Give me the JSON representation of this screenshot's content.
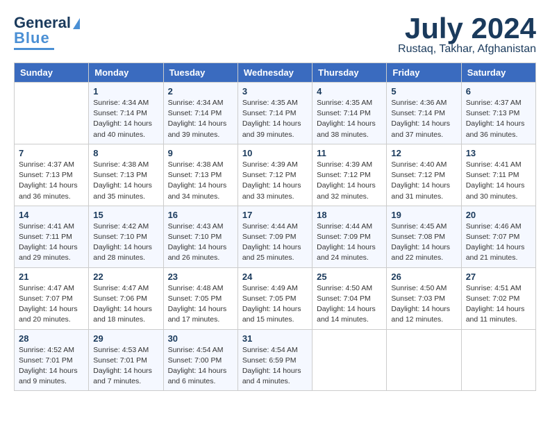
{
  "header": {
    "logo_line1": "General",
    "logo_line2": "Blue",
    "month": "July 2024",
    "location": "Rustaq, Takhar, Afghanistan"
  },
  "days_of_week": [
    "Sunday",
    "Monday",
    "Tuesday",
    "Wednesday",
    "Thursday",
    "Friday",
    "Saturday"
  ],
  "weeks": [
    [
      {
        "num": "",
        "sunrise": "",
        "sunset": "",
        "daylight": ""
      },
      {
        "num": "1",
        "sunrise": "Sunrise: 4:34 AM",
        "sunset": "Sunset: 7:14 PM",
        "daylight": "Daylight: 14 hours and 40 minutes."
      },
      {
        "num": "2",
        "sunrise": "Sunrise: 4:34 AM",
        "sunset": "Sunset: 7:14 PM",
        "daylight": "Daylight: 14 hours and 39 minutes."
      },
      {
        "num": "3",
        "sunrise": "Sunrise: 4:35 AM",
        "sunset": "Sunset: 7:14 PM",
        "daylight": "Daylight: 14 hours and 39 minutes."
      },
      {
        "num": "4",
        "sunrise": "Sunrise: 4:35 AM",
        "sunset": "Sunset: 7:14 PM",
        "daylight": "Daylight: 14 hours and 38 minutes."
      },
      {
        "num": "5",
        "sunrise": "Sunrise: 4:36 AM",
        "sunset": "Sunset: 7:14 PM",
        "daylight": "Daylight: 14 hours and 37 minutes."
      },
      {
        "num": "6",
        "sunrise": "Sunrise: 4:37 AM",
        "sunset": "Sunset: 7:13 PM",
        "daylight": "Daylight: 14 hours and 36 minutes."
      }
    ],
    [
      {
        "num": "7",
        "sunrise": "Sunrise: 4:37 AM",
        "sunset": "Sunset: 7:13 PM",
        "daylight": "Daylight: 14 hours and 36 minutes."
      },
      {
        "num": "8",
        "sunrise": "Sunrise: 4:38 AM",
        "sunset": "Sunset: 7:13 PM",
        "daylight": "Daylight: 14 hours and 35 minutes."
      },
      {
        "num": "9",
        "sunrise": "Sunrise: 4:38 AM",
        "sunset": "Sunset: 7:13 PM",
        "daylight": "Daylight: 14 hours and 34 minutes."
      },
      {
        "num": "10",
        "sunrise": "Sunrise: 4:39 AM",
        "sunset": "Sunset: 7:12 PM",
        "daylight": "Daylight: 14 hours and 33 minutes."
      },
      {
        "num": "11",
        "sunrise": "Sunrise: 4:39 AM",
        "sunset": "Sunset: 7:12 PM",
        "daylight": "Daylight: 14 hours and 32 minutes."
      },
      {
        "num": "12",
        "sunrise": "Sunrise: 4:40 AM",
        "sunset": "Sunset: 7:12 PM",
        "daylight": "Daylight: 14 hours and 31 minutes."
      },
      {
        "num": "13",
        "sunrise": "Sunrise: 4:41 AM",
        "sunset": "Sunset: 7:11 PM",
        "daylight": "Daylight: 14 hours and 30 minutes."
      }
    ],
    [
      {
        "num": "14",
        "sunrise": "Sunrise: 4:41 AM",
        "sunset": "Sunset: 7:11 PM",
        "daylight": "Daylight: 14 hours and 29 minutes."
      },
      {
        "num": "15",
        "sunrise": "Sunrise: 4:42 AM",
        "sunset": "Sunset: 7:10 PM",
        "daylight": "Daylight: 14 hours and 28 minutes."
      },
      {
        "num": "16",
        "sunrise": "Sunrise: 4:43 AM",
        "sunset": "Sunset: 7:10 PM",
        "daylight": "Daylight: 14 hours and 26 minutes."
      },
      {
        "num": "17",
        "sunrise": "Sunrise: 4:44 AM",
        "sunset": "Sunset: 7:09 PM",
        "daylight": "Daylight: 14 hours and 25 minutes."
      },
      {
        "num": "18",
        "sunrise": "Sunrise: 4:44 AM",
        "sunset": "Sunset: 7:09 PM",
        "daylight": "Daylight: 14 hours and 24 minutes."
      },
      {
        "num": "19",
        "sunrise": "Sunrise: 4:45 AM",
        "sunset": "Sunset: 7:08 PM",
        "daylight": "Daylight: 14 hours and 22 minutes."
      },
      {
        "num": "20",
        "sunrise": "Sunrise: 4:46 AM",
        "sunset": "Sunset: 7:07 PM",
        "daylight": "Daylight: 14 hours and 21 minutes."
      }
    ],
    [
      {
        "num": "21",
        "sunrise": "Sunrise: 4:47 AM",
        "sunset": "Sunset: 7:07 PM",
        "daylight": "Daylight: 14 hours and 20 minutes."
      },
      {
        "num": "22",
        "sunrise": "Sunrise: 4:47 AM",
        "sunset": "Sunset: 7:06 PM",
        "daylight": "Daylight: 14 hours and 18 minutes."
      },
      {
        "num": "23",
        "sunrise": "Sunrise: 4:48 AM",
        "sunset": "Sunset: 7:05 PM",
        "daylight": "Daylight: 14 hours and 17 minutes."
      },
      {
        "num": "24",
        "sunrise": "Sunrise: 4:49 AM",
        "sunset": "Sunset: 7:05 PM",
        "daylight": "Daylight: 14 hours and 15 minutes."
      },
      {
        "num": "25",
        "sunrise": "Sunrise: 4:50 AM",
        "sunset": "Sunset: 7:04 PM",
        "daylight": "Daylight: 14 hours and 14 minutes."
      },
      {
        "num": "26",
        "sunrise": "Sunrise: 4:50 AM",
        "sunset": "Sunset: 7:03 PM",
        "daylight": "Daylight: 14 hours and 12 minutes."
      },
      {
        "num": "27",
        "sunrise": "Sunrise: 4:51 AM",
        "sunset": "Sunset: 7:02 PM",
        "daylight": "Daylight: 14 hours and 11 minutes."
      }
    ],
    [
      {
        "num": "28",
        "sunrise": "Sunrise: 4:52 AM",
        "sunset": "Sunset: 7:01 PM",
        "daylight": "Daylight: 14 hours and 9 minutes."
      },
      {
        "num": "29",
        "sunrise": "Sunrise: 4:53 AM",
        "sunset": "Sunset: 7:01 PM",
        "daylight": "Daylight: 14 hours and 7 minutes."
      },
      {
        "num": "30",
        "sunrise": "Sunrise: 4:54 AM",
        "sunset": "Sunset: 7:00 PM",
        "daylight": "Daylight: 14 hours and 6 minutes."
      },
      {
        "num": "31",
        "sunrise": "Sunrise: 4:54 AM",
        "sunset": "Sunset: 6:59 PM",
        "daylight": "Daylight: 14 hours and 4 minutes."
      },
      {
        "num": "",
        "sunrise": "",
        "sunset": "",
        "daylight": ""
      },
      {
        "num": "",
        "sunrise": "",
        "sunset": "",
        "daylight": ""
      },
      {
        "num": "",
        "sunrise": "",
        "sunset": "",
        "daylight": ""
      }
    ]
  ]
}
